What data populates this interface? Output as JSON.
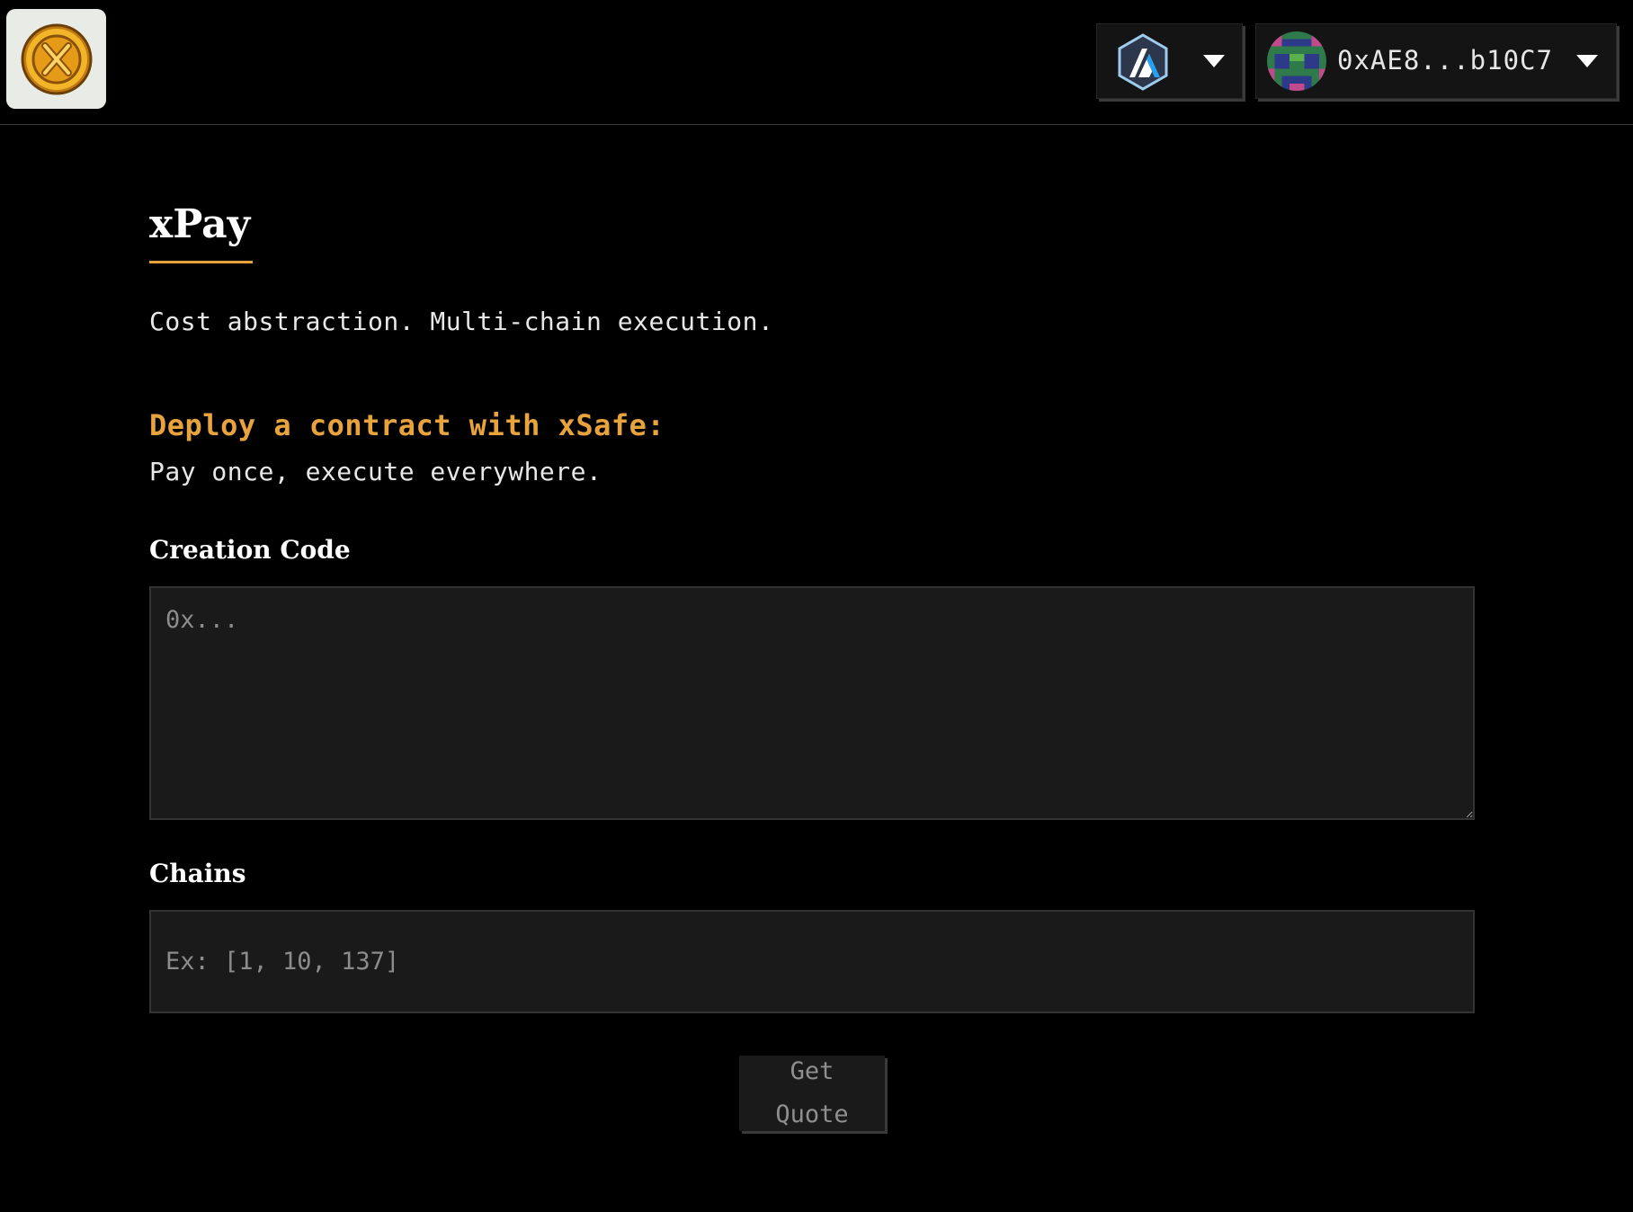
{
  "header": {
    "logo_icon": "xsafe-coin-logo",
    "network": {
      "icon": "arbitrum-icon",
      "caret_icon": "chevron-down-icon"
    },
    "account": {
      "address": "0xAE8...b10C7",
      "avatar_icon": "pixel-avatar",
      "caret_icon": "chevron-down-icon"
    }
  },
  "main": {
    "title": "xPay",
    "tagline": "Cost abstraction. Multi-chain execution.",
    "deploy_heading": "Deploy a contract with xSafe:",
    "deploy_sub": "Pay once, execute everywhere.",
    "creation_code": {
      "label": "Creation Code",
      "placeholder": "0x...",
      "value": ""
    },
    "chains": {
      "label": "Chains",
      "placeholder": "Ex: [1, 10, 137]",
      "value": ""
    },
    "quote_button": "Get Quote"
  },
  "colors": {
    "background": "#000000",
    "accent": "#e8a33d",
    "input_bg": "#1a1a1a",
    "placeholder": "#8c8c8c"
  }
}
